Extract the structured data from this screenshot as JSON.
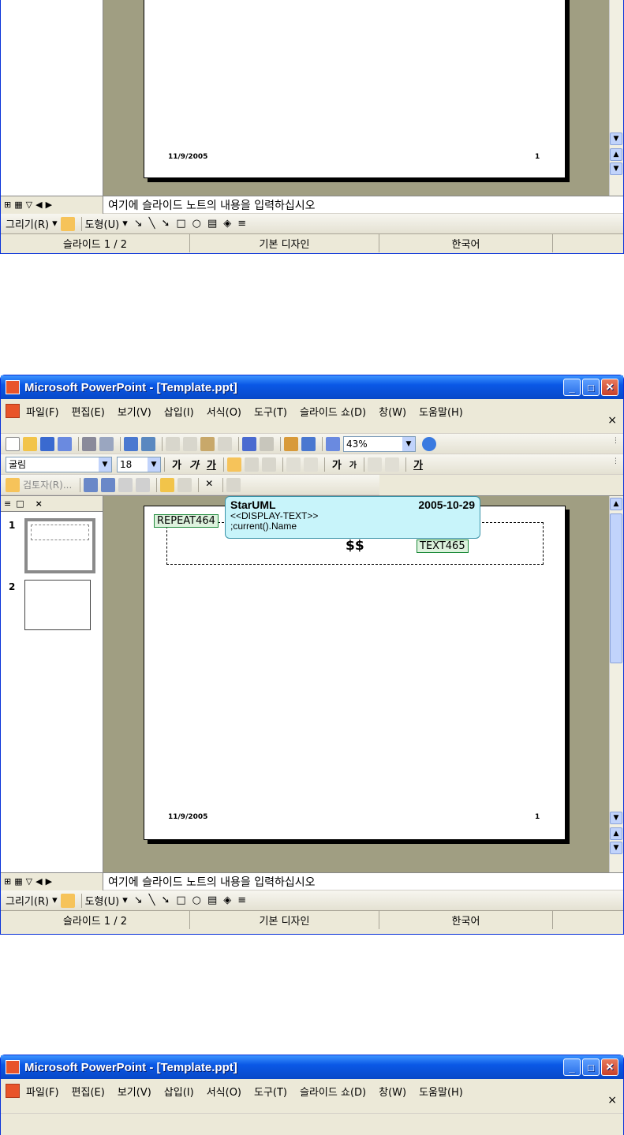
{
  "window": {
    "title": "Microsoft PowerPoint - [Template.ppt]",
    "minimize": "_",
    "maximize": "□",
    "close": "✕"
  },
  "menu": {
    "items": [
      "파일(F)",
      "편집(E)",
      "보기(V)",
      "삽입(I)",
      "서식(O)",
      "도구(T)",
      "슬라이드 쇼(D)",
      "창(W)",
      "도움말(H)"
    ],
    "doc_close": "×"
  },
  "toolbar": {
    "zoom": "43%"
  },
  "format_toolbar": {
    "font_name": "굴림",
    "font_size": "18",
    "bold": "가",
    "italic": "가",
    "underline": "가",
    "grow_font": "가",
    "shrink_font": "가",
    "font_color_label": "가"
  },
  "review_toolbar": {
    "reviewer": "검토자(R)..."
  },
  "left_pane": {
    "tab_outline": "≡",
    "tab_slides": "□",
    "tab_close": "×",
    "slides": [
      "1",
      "2"
    ]
  },
  "slide": {
    "footer_date": "11/9/2005",
    "footer_page": "1",
    "repeat_field": "REPEAT464",
    "text_field": "TEXT465",
    "dollar": "$$"
  },
  "tooltip": {
    "author": "StarUML",
    "date": "2005-10-29",
    "line1": "<<DISPLAY-TEXT>>",
    "line2": ";current().Name"
  },
  "notes": {
    "placeholder": "여기에 슬라이드 노트의 내용을 입력하십시오"
  },
  "draw_toolbar": {
    "draw": "그리기(R)",
    "autoshapes": "도형(U)"
  },
  "status": {
    "slide": "슬라이드 1 / 2",
    "design": "기본 디자인",
    "language": "한국어"
  },
  "colors": {
    "title_blue": "#0a58e6",
    "workspace": "#a09e82",
    "tooltip_bg": "#c8f4fa",
    "field_bg": "#ddf2dd"
  }
}
